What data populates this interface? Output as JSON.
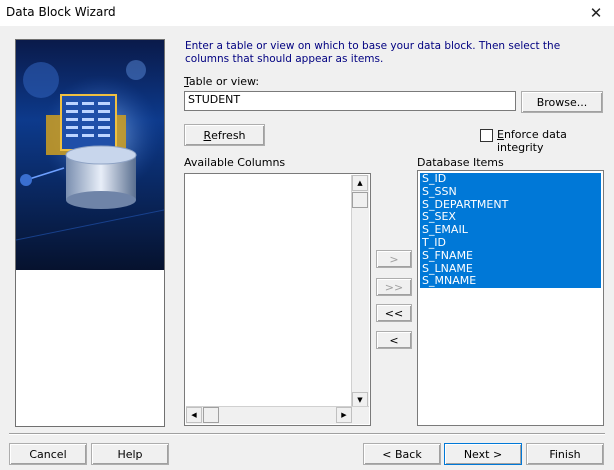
{
  "window": {
    "title": "Data Block Wizard",
    "close_glyph": "✕"
  },
  "instructions": "Enter a table or view on which to base your data block. Then select the columns that should appear as items.",
  "table": {
    "label_first": "T",
    "label_rest": "able or view:",
    "value": "STUDENT",
    "browse_label": "Browse..."
  },
  "refresh": {
    "label_first": "R",
    "label_rest": "efresh"
  },
  "enforce": {
    "label_first": "E",
    "label_rest": "nforce data integrity",
    "checked": false
  },
  "available": {
    "label": "Available Columns",
    "items": []
  },
  "database": {
    "label": "Database Items",
    "items": [
      "S_ID",
      "S_SSN",
      "S_DEPARTMENT",
      "S_SEX",
      "S_EMAIL",
      "T_ID",
      "S_FNAME",
      "S_LNAME",
      "S_MNAME"
    ]
  },
  "move_buttons": {
    "add_one": ">",
    "add_all": ">>",
    "remove_all": "<<",
    "remove_one": "<"
  },
  "footer": {
    "cancel": "Cancel",
    "help": "Help",
    "back": "< Back",
    "next": "Next >",
    "finish": "Finish"
  },
  "colors": {
    "selection": "#0078d7",
    "instruction_text": "#000080"
  }
}
